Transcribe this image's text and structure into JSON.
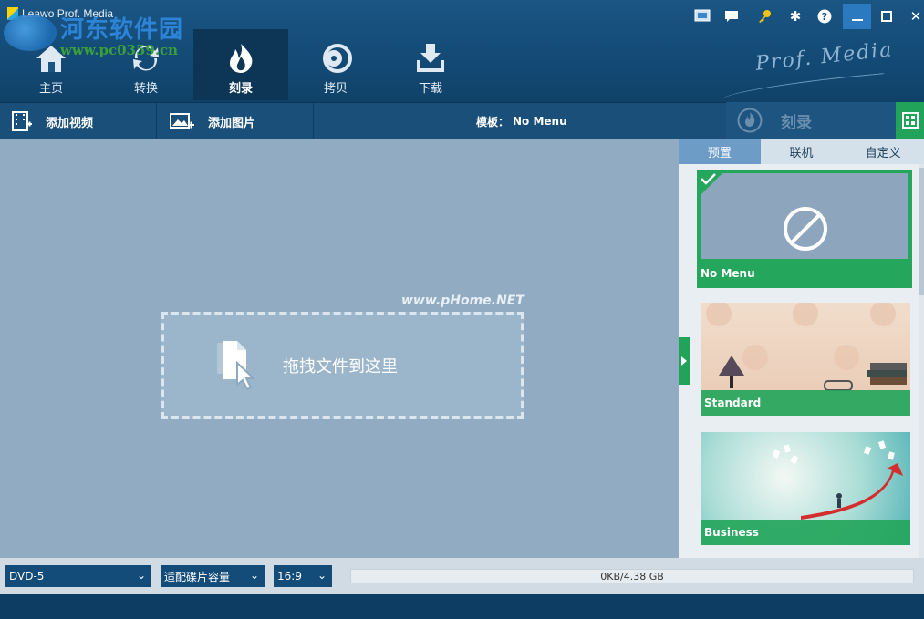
{
  "app": {
    "title": "Leawo Prof. Media",
    "brand": "Prof. Media"
  },
  "watermark": {
    "site_cn": "河东软件园",
    "site_url": "www.pc0359.cn",
    "overlay": "www.pHome.NET"
  },
  "nav": [
    {
      "label": "主页",
      "icon": "home-icon"
    },
    {
      "label": "转换",
      "icon": "convert-icon"
    },
    {
      "label": "刻录",
      "icon": "burn-icon",
      "active": true
    },
    {
      "label": "拷贝",
      "icon": "copy-disc-icon"
    },
    {
      "label": "下载",
      "icon": "download-icon"
    }
  ],
  "toolbar": {
    "add_video": "添加视频",
    "add_image": "添加图片",
    "template_prefix": "模板：",
    "template_value": "No Menu",
    "burn": "刻录"
  },
  "drop": {
    "text": "拖拽文件到这里"
  },
  "panel": {
    "tabs": [
      "预置",
      "联机",
      "自定义"
    ],
    "templates": [
      {
        "label": "No Menu",
        "selected": true
      },
      {
        "label": "Standard"
      },
      {
        "label": "Business"
      }
    ]
  },
  "bottom": {
    "disc_type": "DVD-5",
    "quality": "适配碟片容量",
    "aspect": "16:9",
    "capacity": "0KB/4.38 GB",
    "capacity_fraction": 0
  },
  "colors": {
    "accent_green": "#24a65c",
    "nav_bg": "#134a75",
    "main_bg": "#90abc2"
  }
}
